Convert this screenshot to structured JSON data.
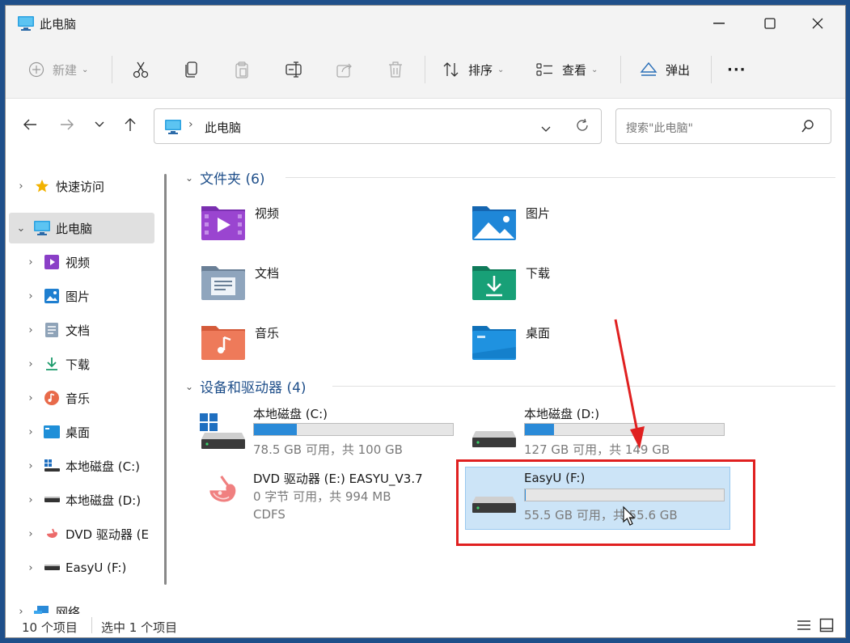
{
  "window": {
    "title": "此电脑"
  },
  "toolbar": {
    "new_label": "新建",
    "sort_label": "排序",
    "view_label": "查看",
    "eject_label": "弹出",
    "more_label": "···"
  },
  "address": {
    "location": "此电脑",
    "search_placeholder": "搜索\"此电脑\""
  },
  "sidebar": {
    "items": [
      {
        "label": "快速访问",
        "icon": "star-icon"
      },
      {
        "label": "此电脑",
        "icon": "computer-icon"
      },
      {
        "label": "视频",
        "icon": "video-icon"
      },
      {
        "label": "图片",
        "icon": "pictures-icon"
      },
      {
        "label": "文档",
        "icon": "documents-icon"
      },
      {
        "label": "下载",
        "icon": "download-icon"
      },
      {
        "label": "音乐",
        "icon": "music-icon"
      },
      {
        "label": "桌面",
        "icon": "desktop-icon"
      },
      {
        "label": "本地磁盘 (C:)",
        "icon": "windows-drive-icon"
      },
      {
        "label": "本地磁盘 (D:)",
        "icon": "drive-icon"
      },
      {
        "label": "DVD 驱动器 (E",
        "icon": "dvd-icon"
      },
      {
        "label": "EasyU (F:)",
        "icon": "drive-icon"
      },
      {
        "label": "网络",
        "icon": "network-icon"
      }
    ]
  },
  "folders_group": {
    "title": "文件夹 (6)",
    "items": [
      {
        "label": "视频",
        "icon": "video-folder-icon"
      },
      {
        "label": "图片",
        "icon": "pictures-folder-icon"
      },
      {
        "label": "文档",
        "icon": "documents-folder-icon"
      },
      {
        "label": "下载",
        "icon": "download-folder-icon"
      },
      {
        "label": "音乐",
        "icon": "music-folder-icon"
      },
      {
        "label": "桌面",
        "icon": "desktop-folder-icon"
      }
    ]
  },
  "drives_group": {
    "title": "设备和驱动器 (4)",
    "items": [
      {
        "name": "本地磁盘 (C:)",
        "free": "78.5 GB 可用，共 100 GB",
        "used_fraction": 0.215
      },
      {
        "name": "本地磁盘 (D:)",
        "free": "127 GB 可用，共 149 GB",
        "used_fraction": 0.148
      },
      {
        "name": "DVD 驱动器 (E:) EASYU_V3.7",
        "free": "0 字节 可用，共 994 MB",
        "fs": "CDFS"
      },
      {
        "name": "EasyU (F:)",
        "free": "55.5 GB 可用，共 55.6 GB",
        "used_fraction": 0.002
      }
    ]
  },
  "status": {
    "count": "10 个项目",
    "selected": "选中 1 个项目"
  },
  "colors": {
    "accent": "#1f4f8a",
    "bar_fill": "#2a8ad8",
    "selection": "#cce4f7",
    "annotation": "#e02020"
  }
}
